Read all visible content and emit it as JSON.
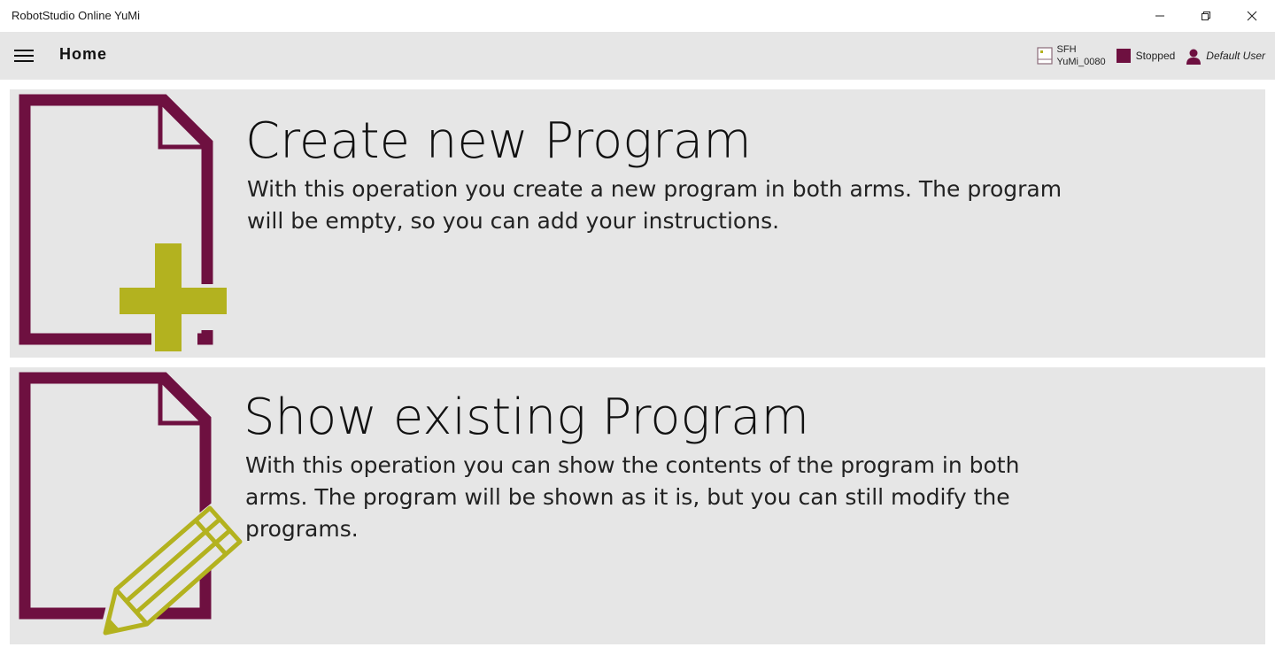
{
  "window": {
    "title": "RobotStudio Online YuMi",
    "controls": {
      "minimize_icon": "minimize-icon",
      "restore_icon": "restore-icon",
      "close_icon": "close-icon"
    }
  },
  "header": {
    "menu_icon": "hamburger-menu-icon",
    "title": "Home",
    "controller": {
      "icon": "controller-icon",
      "line1": "SFH",
      "line2": "YuMi_0080"
    },
    "state": {
      "label": "Stopped",
      "color": "#6e1040"
    },
    "user": {
      "icon": "user-icon",
      "label": "Default User"
    }
  },
  "actions": [
    {
      "icon": "new-document-icon",
      "title": "Create new Program",
      "description": "With this operation you create a new program in both arms. The program will be empty, so you can add your instructions."
    },
    {
      "icon": "edit-document-icon",
      "title": "Show existing Program",
      "description": "With this operation you can show the contents of the program in both arms. The program will be shown as it is, but you can still modify the programs."
    }
  ],
  "colors": {
    "accent_primary": "#6e1040",
    "accent_secondary": "#b3b21f",
    "panel_background": "#e6e6e6"
  }
}
